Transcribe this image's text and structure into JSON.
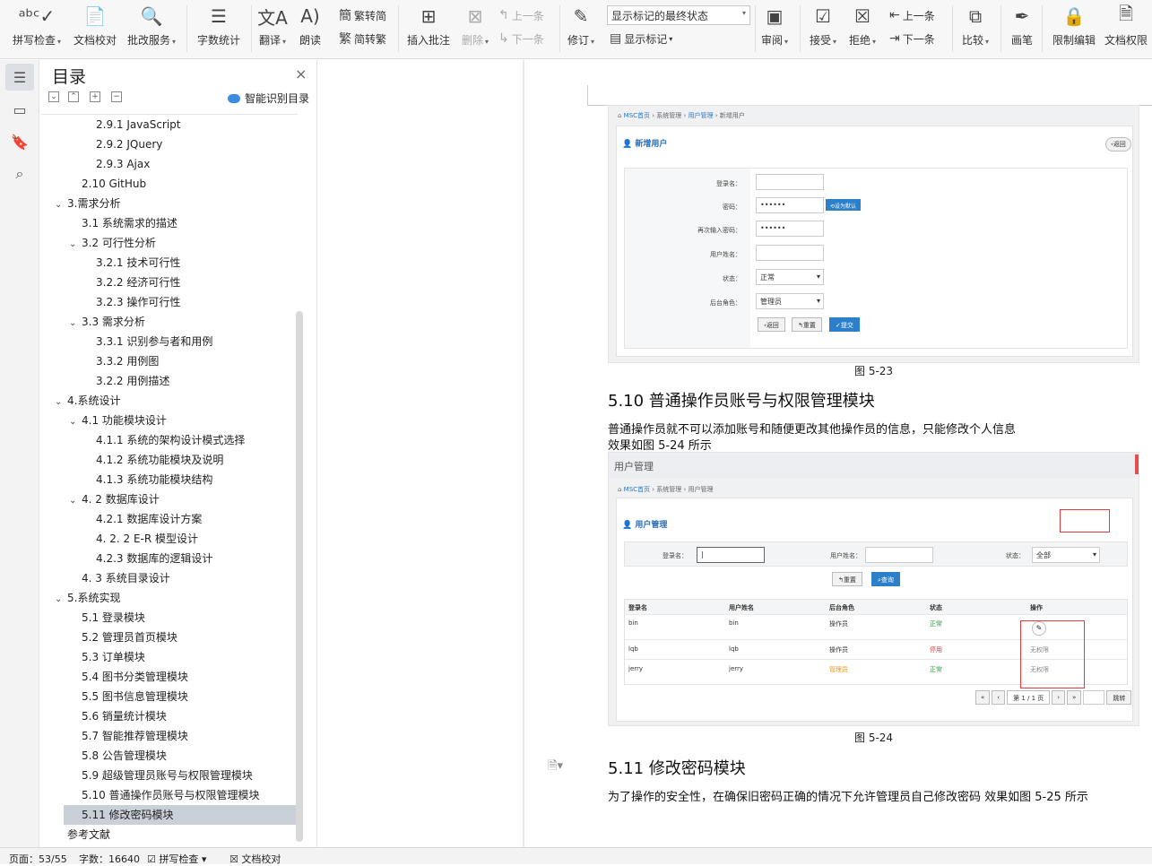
{
  "toolbar": {
    "spell_check": "拼写检查",
    "doc_proof": "文档校对",
    "review_service": "批改服务",
    "word_count": "字数统计",
    "translate": "翻译",
    "read_aloud": "朗读",
    "trad_to_simp": "繁转简",
    "simp_to_trad": "简转繁",
    "insert_comment": "插入批注",
    "delete": "删除",
    "prev_comment": "上一条",
    "next_comment": "下一条",
    "track_changes": "修订",
    "markup_state": "显示标记的最终状态",
    "show_markup": "显示标记",
    "review": "审阅",
    "accept": "接受",
    "reject": "拒绝",
    "prev_change": "上一条",
    "next_change": "下一条",
    "compare": "比较",
    "pen": "画笔",
    "restrict_edit": "限制编辑",
    "doc_permission": "文档权限"
  },
  "nav": {
    "title": "目录",
    "smart_toc": "智能识别目录",
    "items": [
      {
        "label": "2.9.1 JavaScript"
      },
      {
        "label": "2.9.2 JQuery"
      },
      {
        "label": "2.9.3 Ajax"
      },
      {
        "label": "2.10 GitHub"
      },
      {
        "label": "3.需求分析"
      },
      {
        "label": "3.1  系统需求的描述"
      },
      {
        "label": "3.2  可行性分析"
      },
      {
        "label": "3.2.1 技术可行性"
      },
      {
        "label": "3.2.2 经济可行性"
      },
      {
        "label": "3.2.3 操作可行性"
      },
      {
        "label": "3.3  需求分析"
      },
      {
        "label": "3.3.1  识别参与者和用例"
      },
      {
        "label": "3.3.2  用例图"
      },
      {
        "label": "3.2.2 用例描述"
      },
      {
        "label": "4.系统设计"
      },
      {
        "label": "4.1 功能模块设计"
      },
      {
        "label": "4.1.1 系统的架构设计模式选择"
      },
      {
        "label": "4.1.2 系统功能模块及说明"
      },
      {
        "label": "4.1.3 系统功能模块结构"
      },
      {
        "label": "4. 2 数据库设计"
      },
      {
        "label": "4.2.1 数据库设计方案"
      },
      {
        "label": "4. 2. 2  E-R 模型设计"
      },
      {
        "label": "4.2.3 数据库的逻辑设计"
      },
      {
        "label": "4. 3   系统目录设计"
      },
      {
        "label": "5.系统实现"
      },
      {
        "label": "5.1  登录模块"
      },
      {
        "label": "5.2  管理员首页模块"
      },
      {
        "label": "5.3  订单模块"
      },
      {
        "label": "5.4  图书分类管理模块"
      },
      {
        "label": "5.5  图书信息管理模块"
      },
      {
        "label": "5.6  销量统计模块"
      },
      {
        "label": "5.7  智能推荐管理模块"
      },
      {
        "label": "5.8  公告管理模块"
      },
      {
        "label": "5.9  超级管理员账号与权限管理模块"
      },
      {
        "label": "5.10  普通操作员账号与权限管理模块"
      },
      {
        "label": "5.11  修改密码模块"
      },
      {
        "label": "参考文献"
      }
    ]
  },
  "doc": {
    "fig1": {
      "crumb_home": "MSC首页",
      "crumb_sys": "系统管理",
      "crumb_user": "用户管理",
      "crumb_new": "新增用户",
      "panel_title": "新增用户",
      "back_top": "返回",
      "login_label": "登录名：",
      "pwd_label": "密码：",
      "pwd_value": "••••••",
      "set_default": "设为默认",
      "repwd_label": "再次输入密码：",
      "repwd_value": "••••••",
      "name_label": "用户姓名：",
      "status_label": "状态：",
      "status_value": "正常",
      "role_label": "后台角色：",
      "role_value": "管理员",
      "btn_back": "返回",
      "btn_reset": "重置",
      "btn_submit": "提交"
    },
    "caption1": "图 5-23",
    "h_510": "5.10  普通操作员账号与权限管理模块",
    "para1": "普通操作员就不可以添加账号和随便更改其他操作员的信息，只能修改个人信息",
    "para2": "效果如图 5-24 所示",
    "fig2": {
      "window_title": "用户管理",
      "crumb_home": "MSC首页",
      "crumb_sys": "系统管理",
      "crumb_user": "用户管理",
      "panel_title": "用户管理",
      "login_label": "登录名：",
      "name_label": "用户姓名：",
      "status_label": "状态：",
      "status_value": "全部",
      "btn_reset": "重置",
      "btn_query": "查询",
      "columns": [
        "登录名",
        "用户姓名",
        "后台角色",
        "状态",
        "操作"
      ],
      "rows": [
        {
          "login": "bin",
          "name": "bin",
          "role": "操作员",
          "status": "正常",
          "action": ""
        },
        {
          "login": "lqb",
          "name": "lqb",
          "role": "操作员",
          "status": "停用",
          "action": "无权限"
        },
        {
          "login": "jerry",
          "name": "jerry",
          "role": "管理员",
          "status": "正常",
          "action": "无权限"
        }
      ],
      "page_info": "第 1 / 1 页",
      "jump": "跳转"
    },
    "caption2": "图 5-24",
    "h_511": "5.11  修改密码模块",
    "para3": "为了操作的安全性，在确保旧密码正确的情况下允许管理员自己修改密码  效果如图 5-25 所示"
  },
  "status": {
    "page": "页面：53/55",
    "words": "字数：16640",
    "spell": "拼写检查",
    "proof": "文档校对"
  },
  "colors": {
    "accent": "#2c7fc9",
    "selected": "#c9d0d8",
    "status_ok": "#2e9e3c",
    "status_stop": "#e23c3c",
    "role_admin": "#e8962c"
  }
}
